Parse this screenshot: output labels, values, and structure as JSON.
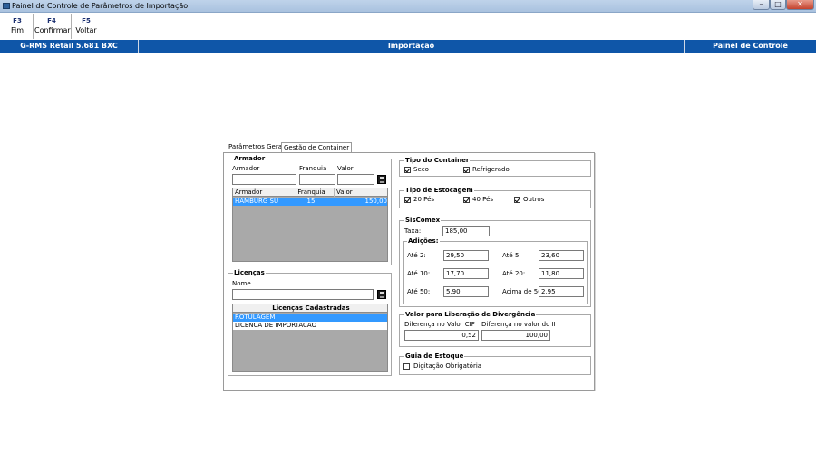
{
  "window": {
    "title": "Painel de Controle de Parâmetros de Importação",
    "min_glyph": "–",
    "max_glyph": "□",
    "close_glyph": "✕"
  },
  "toolbar": {
    "buttons": [
      {
        "key": "F3",
        "label": "Fim"
      },
      {
        "key": "F4",
        "label": "Confirmar"
      },
      {
        "key": "F5",
        "label": "Voltar"
      }
    ]
  },
  "header": {
    "left": "G-RMS Retail 5.681 BXC",
    "center": "Importação",
    "right": "Painel de Controle"
  },
  "tabs": [
    "Parâmetros Gerais",
    "Gestão de Container"
  ],
  "armador": {
    "title": "Armador",
    "labels": {
      "armador": "Armador",
      "franquia": "Franquia",
      "valor": "Valor"
    },
    "inputs": {
      "armador": "",
      "franquia": "",
      "valor": ""
    },
    "columns": [
      "Armador",
      "Franquia",
      "Valor"
    ],
    "rows": [
      {
        "armador": "HAMBURG SU",
        "franquia": "15",
        "valor": "150,00"
      }
    ]
  },
  "licencas": {
    "title": "Licenças",
    "nome_label": "Nome",
    "nome_value": "",
    "column": "Licenças Cadastradas",
    "rows": [
      "ROTULAGEM",
      "LICENCA DE IMPORTACAO"
    ]
  },
  "tipo_container": {
    "title": "Tipo do Container",
    "options": [
      {
        "label": "Seco",
        "checked": true
      },
      {
        "label": "Refrigerado",
        "checked": true
      }
    ]
  },
  "tipo_estocagem": {
    "title": "Tipo de Estocagem",
    "options": [
      {
        "label": "20 Pés",
        "checked": true
      },
      {
        "label": "40 Pés",
        "checked": true
      },
      {
        "label": "Outros",
        "checked": true
      }
    ]
  },
  "siscomex": {
    "title": "SisComex",
    "taxa_label": "Taxa:",
    "taxa_value": "185,00",
    "adicoes": {
      "title": "Adições:",
      "items": [
        {
          "label": "Até 2:",
          "value": "29,50"
        },
        {
          "label": "Até 5:",
          "value": "23,60"
        },
        {
          "label": "Até 10:",
          "value": "17,70"
        },
        {
          "label": "Até 20:",
          "value": "11,80"
        },
        {
          "label": "Até 50:",
          "value": "5,90"
        },
        {
          "label": "Acima de 50:",
          "value": "2,95"
        }
      ]
    }
  },
  "divergencia": {
    "title": "Valor para Liberação de Divergência",
    "cif_label": "Diferença no Valor CIF",
    "cif_value": "0,52",
    "ii_label": "Diferença no valor do II",
    "ii_value": "100,00"
  },
  "guia": {
    "title": "Guia de Estoque",
    "option": {
      "label": "Digitação Obrigatória",
      "checked": false
    }
  }
}
